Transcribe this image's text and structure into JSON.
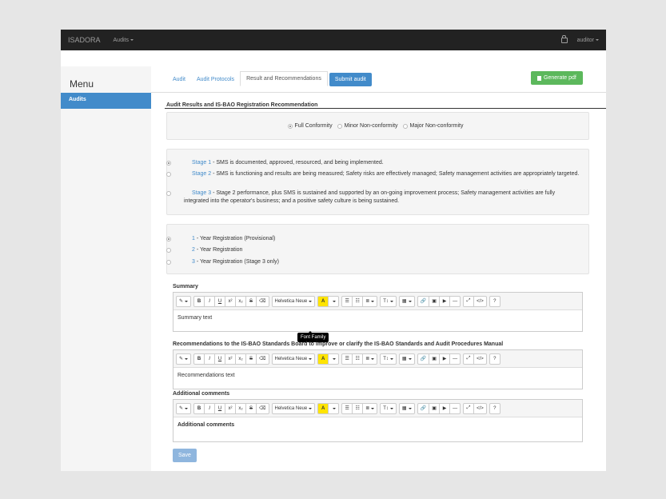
{
  "navbar": {
    "brand": "ISADORA",
    "menu": "Audits",
    "user": "auditor"
  },
  "sidebar": {
    "title": "Menu",
    "items": [
      {
        "label": "Audits"
      }
    ]
  },
  "tabs": [
    {
      "label": "Audit"
    },
    {
      "label": "Audit Protocols"
    },
    {
      "label": "Result and Recommendations"
    }
  ],
  "buttons": {
    "submit": "Submit audit",
    "generate_pdf": "Generate pdf",
    "save": "Save"
  },
  "section_title": "Audit Results and IS-BAO Registration Recommendation",
  "conformity": [
    {
      "label": "Full Conformity",
      "checked": true
    },
    {
      "label": "Minor Non-conformity",
      "checked": false
    },
    {
      "label": "Major Non-conformity",
      "checked": false
    }
  ],
  "stages": [
    {
      "label": "Stage 1",
      "text": " - SMS is documented, approved, resourced, and being implemented.",
      "checked": true
    },
    {
      "label": "Stage 2",
      "text": " - SMS is functioning and results are being measured; Safety risks are effectively managed; Safety management activities are appropriately targeted.",
      "checked": false
    },
    {
      "label": "Stage 3",
      "text": " - Stage 2 performance, plus SMS is sustained and supported by an on-going improvement process; Safety management activities are fully integrated into the operator's business; and a positive safety culture is being sustained.",
      "checked": false
    }
  ],
  "registrations": [
    {
      "label": "1",
      "text": " - Year Registration (Provisional)",
      "checked": true
    },
    {
      "label": "2",
      "text": " - Year Registration",
      "checked": false
    },
    {
      "label": "3",
      "text": " - Year Registration (Stage 3 only)",
      "checked": false
    }
  ],
  "editors": [
    {
      "label": "Summary",
      "content": "Summary text"
    },
    {
      "label": "Recommendations to the IS-BAO Standards Board to improve or clarify the IS-BAO Standards and Audit Procedures Manual",
      "content": "Recommendations text"
    },
    {
      "label": "Additional comments",
      "content": "Additional comments"
    }
  ],
  "toolbar": {
    "font_family": "Helvetica Neue",
    "tooltip": "Font Family"
  }
}
